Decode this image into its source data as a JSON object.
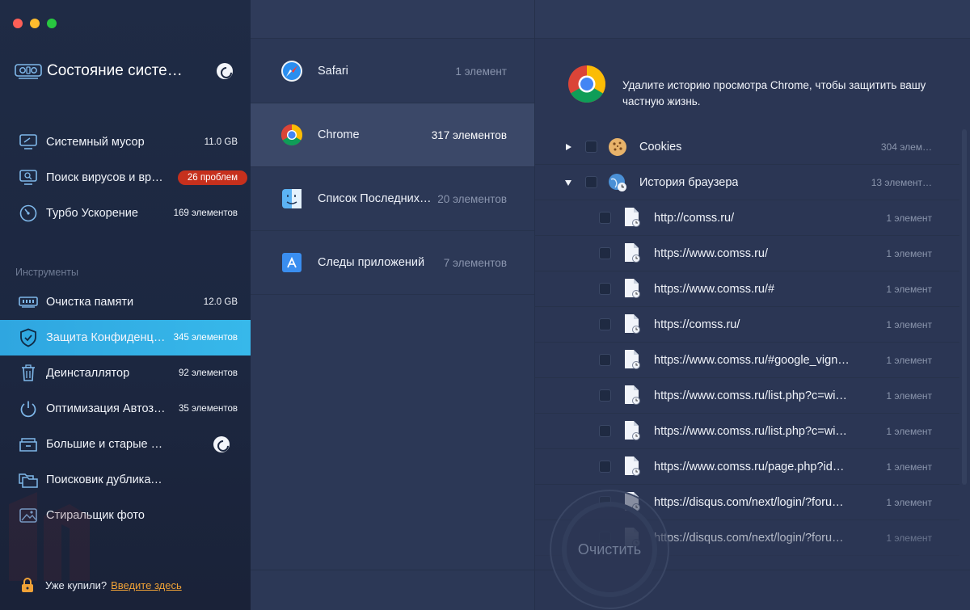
{
  "sidebar": {
    "status_title": "Состояние систе…",
    "section_label": "Инструменты",
    "items": [
      {
        "label": "Системный мусор",
        "value": "11.0 GB"
      },
      {
        "label": "Поиск вирусов и вре…",
        "badge": "26 проблем"
      },
      {
        "label": "Турбо Ускорение",
        "value": "169 элементов"
      },
      {
        "label": "Очистка памяти",
        "value": "12.0 GB"
      },
      {
        "label": "Защита Конфиденциа…",
        "value": "345 элементов"
      },
      {
        "label": "Деинсталлятор",
        "value": "92 элементов"
      },
      {
        "label": "Оптимизация Автоза…",
        "value": "35 элементов"
      },
      {
        "label": "Большие и старые фа…"
      },
      {
        "label": "Поисковик дубликатов"
      },
      {
        "label": "Стиральщик фото"
      }
    ],
    "bought_text": "Уже купили?",
    "bought_link": "Введите здесь"
  },
  "middle": {
    "rows": [
      {
        "name": "Safari",
        "count": "1 элемент"
      },
      {
        "name": "Chrome",
        "count": "317 элементов"
      },
      {
        "name": "Список Последних…",
        "count": "20 элементов"
      },
      {
        "name": "Следы приложений",
        "count": "7 элементов"
      }
    ]
  },
  "right": {
    "hint": "Удалите историю просмотра Chrome, чтобы защитить вашу частную жизнь.",
    "groups": [
      {
        "label": "Cookies",
        "count": "304 элем…"
      },
      {
        "label": "История браузера",
        "count": "13 элемент…"
      }
    ],
    "entries": [
      {
        "url": "http://comss.ru/",
        "count": "1 элемент"
      },
      {
        "url": "https://www.comss.ru/",
        "count": "1 элемент"
      },
      {
        "url": "https://www.comss.ru/#",
        "count": "1 элемент"
      },
      {
        "url": "https://comss.ru/",
        "count": "1 элемент"
      },
      {
        "url": "https://www.comss.ru/#google_vign…",
        "count": "1 элемент"
      },
      {
        "url": "https://www.comss.ru/list.php?c=wi…",
        "count": "1 элемент"
      },
      {
        "url": "https://www.comss.ru/list.php?c=wi…",
        "count": "1 элемент"
      },
      {
        "url": "https://www.comss.ru/page.php?id…",
        "count": "1 элемент"
      },
      {
        "url": "https://disqus.com/next/login/?foru…",
        "count": "1 элемент"
      },
      {
        "url": "https://disqus.com/next/login/?foru…",
        "count": "1 элемент"
      }
    ],
    "clean_button": "Очистить"
  },
  "colors": {
    "sidebar_bg": "#1f2b45",
    "active_item": "#2fa6e0",
    "badge_red": "#c6301d",
    "link_orange": "#f0a237",
    "pane_bg": "#2b3654"
  }
}
